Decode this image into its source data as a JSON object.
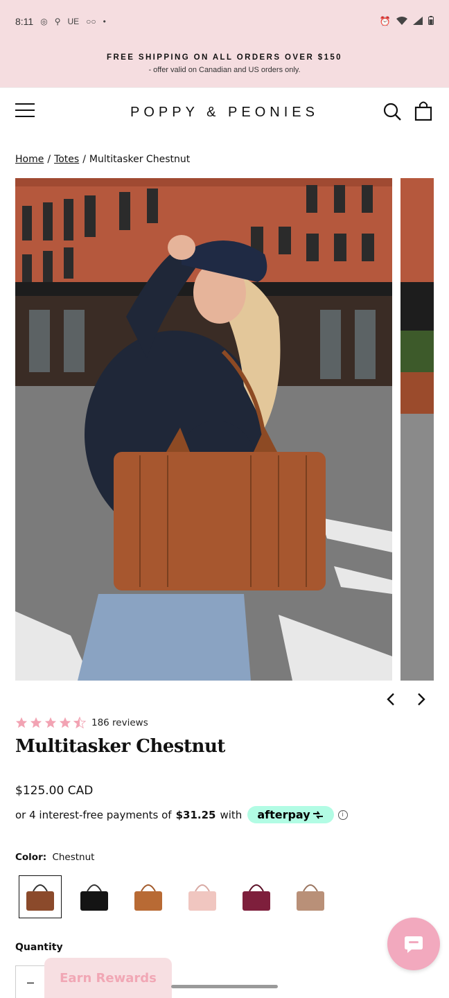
{
  "status_bar": {
    "time": "8:11",
    "left_icons": [
      "whatsapp-icon",
      "notification-icon",
      "UE",
      "voicemail-icon",
      "•"
    ],
    "right_icons": [
      "alarm-icon",
      "wifi-icon",
      "signal-icon",
      "battery-icon"
    ]
  },
  "announcement": {
    "title": "FREE SHIPPING ON ALL ORDERS OVER $150",
    "subtitle": "- offer valid on Canadian and US orders only."
  },
  "header": {
    "brand": "POPPY & PEONIES"
  },
  "breadcrumb": {
    "home": "Home",
    "sep": "/",
    "category": "Totes",
    "current": "Multitasker Chestnut"
  },
  "gallery": {
    "prev_arrow": "‹",
    "next_arrow": "›"
  },
  "rating": {
    "stars": 4.5,
    "reviews": "186 reviews"
  },
  "product": {
    "title": "Multitasker Chestnut",
    "price": "$125.00 CAD",
    "afterpay_prefix": "or 4 interest-free payments of",
    "afterpay_amount": "$31.25",
    "afterpay_with": "with",
    "afterpay_brand": "afterpay",
    "info": "i"
  },
  "color": {
    "label": "Color:",
    "selected": "Chestnut",
    "swatch_colors": [
      "#8b4a2b",
      "#141414",
      "#b86a34",
      "#f0c6c0",
      "#7e1f3c",
      "#b99078"
    ]
  },
  "quantity": {
    "label": "Quantity",
    "minus": "–"
  },
  "rewards": {
    "label": "Earn Rewards"
  },
  "colors": {
    "pink_bg": "#f5dde0",
    "afterpay_mint": "#b2fce4",
    "star_pink": "#f2a3b3",
    "chat_pink": "#f2a9be"
  }
}
